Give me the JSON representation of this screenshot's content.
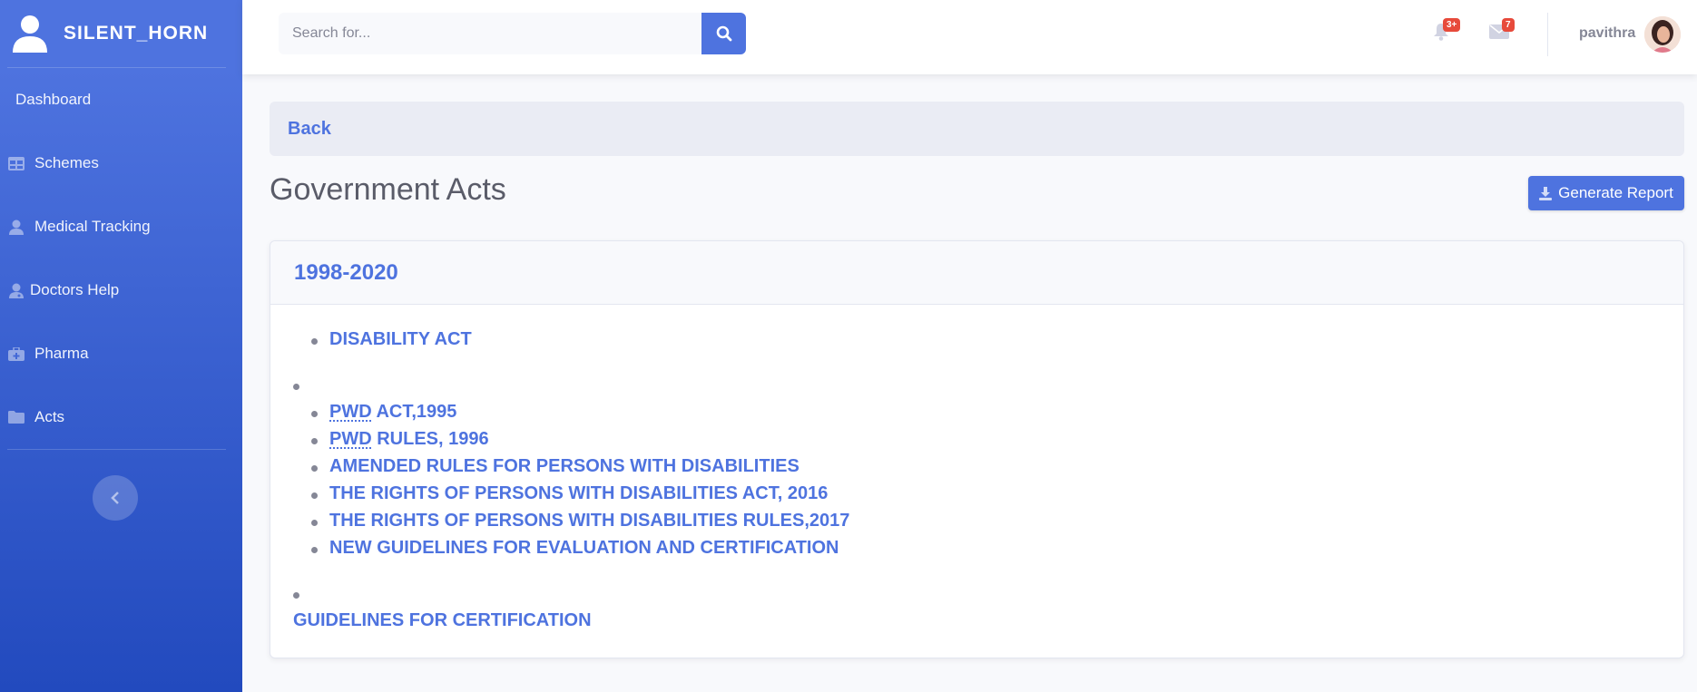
{
  "sidebar": {
    "brand": "SILENT_HORN",
    "items": [
      {
        "label": "Dashboard"
      },
      {
        "label": "Schemes"
      },
      {
        "label": "Medical Tracking"
      },
      {
        "label": "Doctors Help"
      },
      {
        "label": "Pharma"
      },
      {
        "label": "Acts"
      }
    ]
  },
  "topbar": {
    "search_placeholder": "Search for...",
    "alerts_badge": "3+",
    "messages_badge": "7",
    "username": "pavithra"
  },
  "main": {
    "back_label": "Back",
    "page_title": "Government Acts",
    "report_button": "Generate Report",
    "card_title": "1998-2020",
    "list_first": "DISABILITY ACT",
    "list_group": [
      {
        "abbr": "PWD",
        "rest": " ACT,1995"
      },
      {
        "abbr": "PWD",
        "rest": " RULES, 1996"
      },
      {
        "abbr": "",
        "rest": "AMENDED RULES FOR PERSONS WITH DISABILITIES"
      },
      {
        "abbr": "",
        "rest": "THE RIGHTS OF PERSONS WITH DISABILITIES ACT, 2016"
      },
      {
        "abbr": "",
        "rest": "THE RIGHTS OF PERSONS WITH DISABILITIES RULES,2017"
      },
      {
        "abbr": "",
        "rest": "NEW GUIDELINES FOR EVALUATION AND CERTIFICATION"
      }
    ],
    "list_last": "GUIDELINES FOR CERTIFICATION"
  },
  "colors": {
    "primary": "#4e73df",
    "danger": "#e74a3b"
  }
}
